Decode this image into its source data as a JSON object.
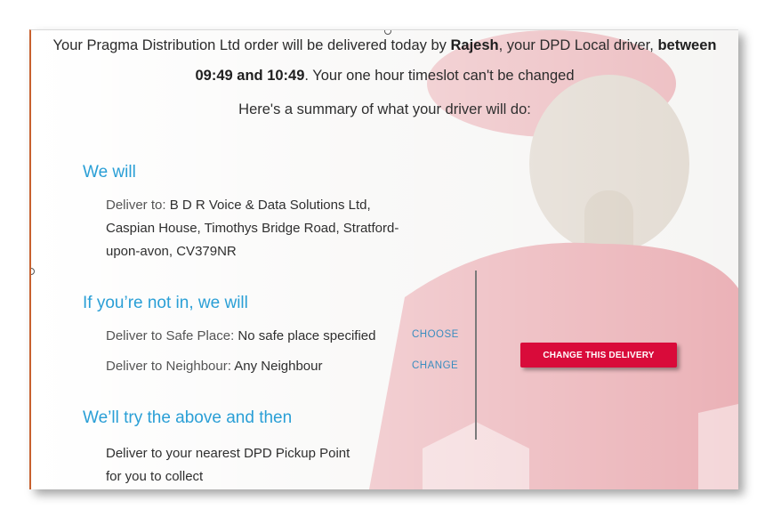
{
  "header": {
    "line1_pre": "Your Pragma Distribution Ltd order will be delivered today by ",
    "driver_name": "Rajesh",
    "line1_mid": ", your DPD Local driver, ",
    "between_label": "between",
    "timeslot": "09:49 and 10:49",
    "line2_post": ". Your one hour timeslot can't be changed"
  },
  "summary_text": "Here's a summary of what your driver will do:",
  "we_will": {
    "title": "We will",
    "deliver_label": "Deliver to: ",
    "address_line1": "B D R Voice & Data Solutions Ltd,",
    "address_line2": "Caspian House, Timothys Bridge Road, Stratford-",
    "address_line3": "upon-avon, CV379NR"
  },
  "not_in": {
    "title": "If you’re not in, we will",
    "safe_place_label": "Deliver to Safe Place: ",
    "safe_place_value": "No safe place specified",
    "safe_place_link": "CHOOSE",
    "neighbour_label": "Deliver to Neighbour: ",
    "neighbour_value": "Any Neighbour",
    "neighbour_link": "CHANGE"
  },
  "then": {
    "title": "We’ll try the above and then",
    "line1": "Deliver to your nearest DPD Pickup Point",
    "line2": "for you to collect"
  },
  "cta_label": "CHANGE THIS DELIVERY",
  "colors": {
    "accent_blue": "#2a9fd6",
    "link_blue": "#3a8dbf",
    "cta_red": "#d90b3a"
  }
}
